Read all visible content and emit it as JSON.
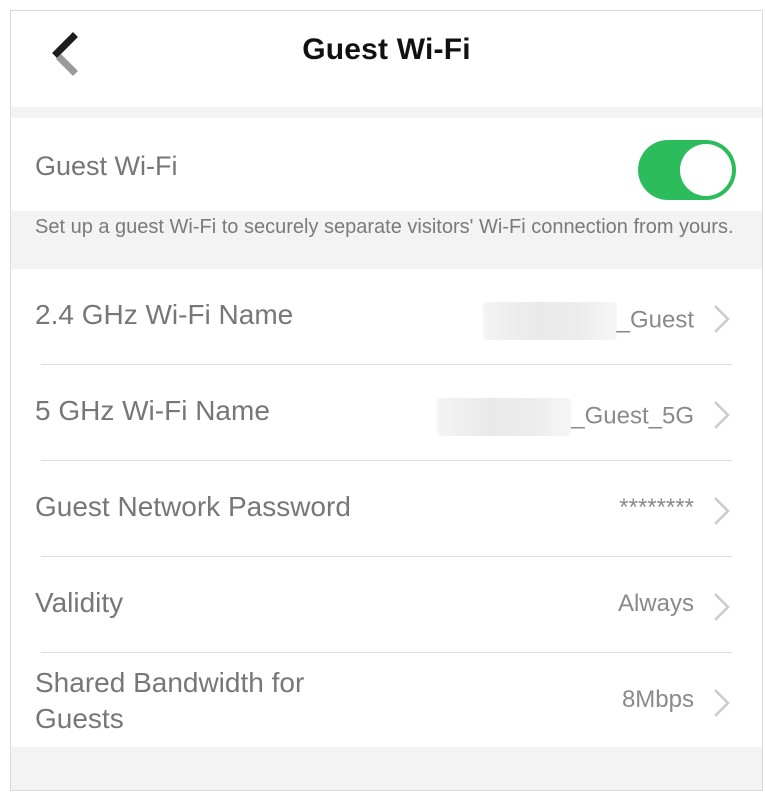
{
  "header": {
    "title": "Guest Wi-Fi",
    "back_icon": "back-arrow-icon"
  },
  "guest_toggle": {
    "label": "Guest Wi-Fi",
    "enabled": true,
    "on_color": "#2dbc5c"
  },
  "description": "Set up a guest Wi-Fi to securely separate visitors' Wi-Fi connection from yours.",
  "settings": [
    {
      "label": "2.4 GHz Wi-Fi Name",
      "value": "_Guest",
      "value_partially_obscured": true
    },
    {
      "label": "5 GHz Wi-Fi Name",
      "value": "_Guest_5G",
      "value_partially_obscured": true
    },
    {
      "label": "Guest Network Password",
      "value": "********"
    },
    {
      "label": "Validity",
      "value": "Always"
    },
    {
      "label": "Shared Bandwidth for Guests",
      "value": "8Mbps"
    }
  ],
  "icons": {
    "chevron": "chevron-right-icon"
  }
}
